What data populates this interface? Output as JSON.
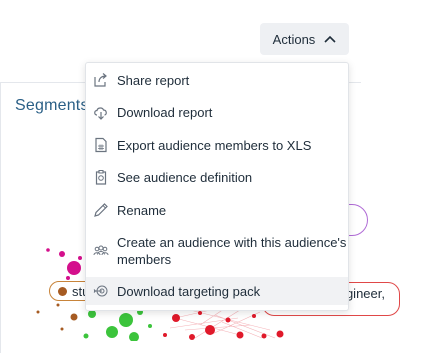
{
  "header": {
    "actions_label": "Actions"
  },
  "segments": {
    "title": "Segments"
  },
  "menu": {
    "items": [
      {
        "label": "Share report",
        "icon": "share-icon"
      },
      {
        "label": "Download report",
        "icon": "cloud-download-icon"
      },
      {
        "label": "Export audience members to XLS",
        "icon": "spreadsheet-icon"
      },
      {
        "label": "See audience definition",
        "icon": "clipboard-icon"
      },
      {
        "label": "Rename",
        "icon": "pencil-icon"
      },
      {
        "label": "Create an audience with this audience's members",
        "icon": "people-icon"
      },
      {
        "label": "Download targeting pack",
        "icon": "target-icon",
        "highlighted": true
      }
    ]
  },
  "graph_labels": {
    "left_pill_text": "stu",
    "right_pill_text": "gineer,"
  },
  "colors": {
    "accent_text": "#2a5f86",
    "node_red": "#e0192a",
    "node_green": "#3cc43c",
    "node_magenta": "#d4108c",
    "node_brown": "#a65b22"
  }
}
